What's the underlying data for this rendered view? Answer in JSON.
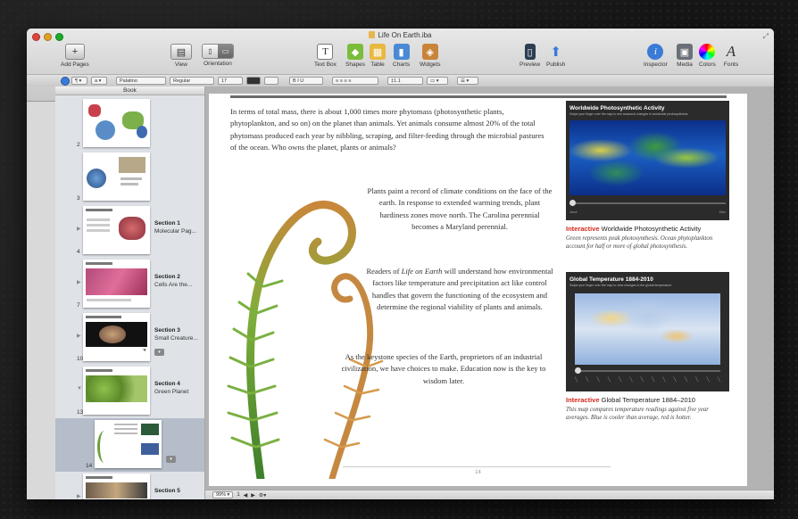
{
  "window": {
    "title": "Life On Earth.iba"
  },
  "toolbar": {
    "add_pages": "Add Pages",
    "view": "View",
    "orientation": "Orientation",
    "text_box": "Text Box",
    "shapes": "Shapes",
    "table": "Table",
    "charts": "Charts",
    "widgets": "Widgets",
    "preview": "Preview",
    "publish": "Publish",
    "inspector": "Inspector",
    "media": "Media",
    "colors": "Colors",
    "fonts": "Fonts"
  },
  "formatbar": {
    "paragraph_style": "Palatino",
    "font_weight": "Regular",
    "font_size": "17",
    "line_spacing": "1.1"
  },
  "sidebar": {
    "header": "Book",
    "rows": [
      {
        "page": "2"
      },
      {
        "page": "3"
      },
      {
        "page": "4",
        "section": "Section 1",
        "subtitle": "Molecular Pag..."
      },
      {
        "page": "7",
        "section": "Section 2",
        "subtitle": "Cells Are the..."
      },
      {
        "page": "10",
        "section": "Section 3",
        "subtitle": "Small Creature..."
      },
      {
        "page": "13",
        "section": "Section 4",
        "subtitle": "Green Planet"
      },
      {
        "page": "14"
      },
      {
        "page": "",
        "section": "Section 5",
        "subtitle": ""
      }
    ]
  },
  "page": {
    "para1": "In terms of total mass, there is about 1,000 times more phytomass (photosynthetic plants, phytoplankton, and so on) on the planet than animals. Yet animals consume almost 20% of the total phytomass produced each year by nibbling, scraping, and filter-feeding through the microbial pastures of the ocean. Who owns the planet, plants or animals?",
    "para2": "Plants paint a record of climate conditions on the face of the earth. In response to extended warming trends, plant hardiness zones move north. The Carolina perennial becomes a Maryland perennial.",
    "para3_pre": "Readers of ",
    "para3_em": "Life on Earth",
    "para3_post": " will understand how environmental factors like temperature and precipitation act like control handles that govern the functioning of the ecosystem and determine the regional viability of plants and animals.",
    "para4": "As the keystone species of the Earth, proprietors of an industrial civilization, we have choices to make. Education now is the key to wisdom later.",
    "page_number": "14"
  },
  "widgets": [
    {
      "image_title": "Worldwide Photosynthetic Activity",
      "image_subtitle": "Swipe your finger over the map to see seasonal changes in worldwide photosynthesis",
      "tag": "Interactive",
      "caption": "Worldwide Photosynthetic Activity",
      "description": "Green represents peak photosynthesis. Ocean phytoplankton account for half or more of global photosynthesis.",
      "axis_left": "June",
      "axis_right": "Dec"
    },
    {
      "image_title": "Global Temperature 1884-2010",
      "image_subtitle": "Swipe your finger over the map to view changes to the global temperature",
      "tag": "Interactive",
      "caption": "Global Temperature 1884–2010",
      "description": "This map compares temperature readings against five year averages. Blue is cooler than average, red is hotter."
    }
  ],
  "status": {
    "zoom": "99%",
    "page": "1"
  },
  "colors": {
    "interactive_tag": "#d5281b",
    "accent": "#3b7bd8"
  }
}
